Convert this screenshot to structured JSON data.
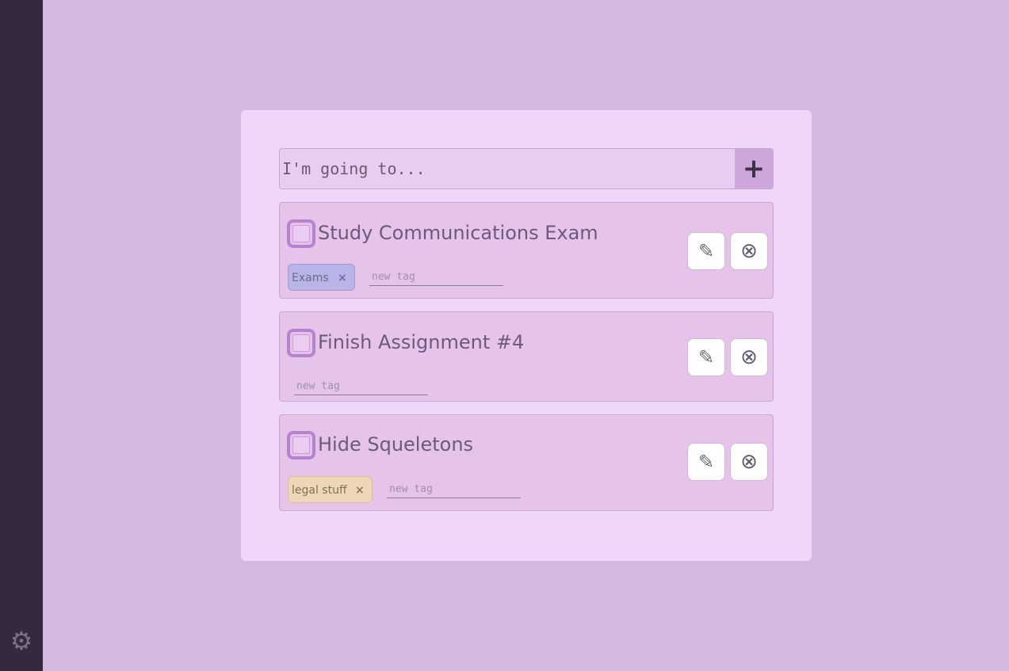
{
  "sidebar": {
    "settings_icon": "⚙"
  },
  "new_task": {
    "placeholder": "I'm going to...",
    "value": "",
    "add_label": "+"
  },
  "tag_placeholder": "new tag",
  "icons": {
    "edit": "✎",
    "delete": "⊗",
    "remove_tag": "×"
  },
  "tasks": [
    {
      "title": "Study Communications Exam",
      "completed": false,
      "tags": [
        {
          "label": "Exams",
          "color": "#b8b4e6"
        }
      ]
    },
    {
      "title": "Finish Assignment #4",
      "completed": false,
      "tags": []
    },
    {
      "title": "Hide Squeletons",
      "completed": false,
      "tags": [
        {
          "label": "legal stuff",
          "color": "#eed7b7"
        }
      ]
    }
  ]
}
